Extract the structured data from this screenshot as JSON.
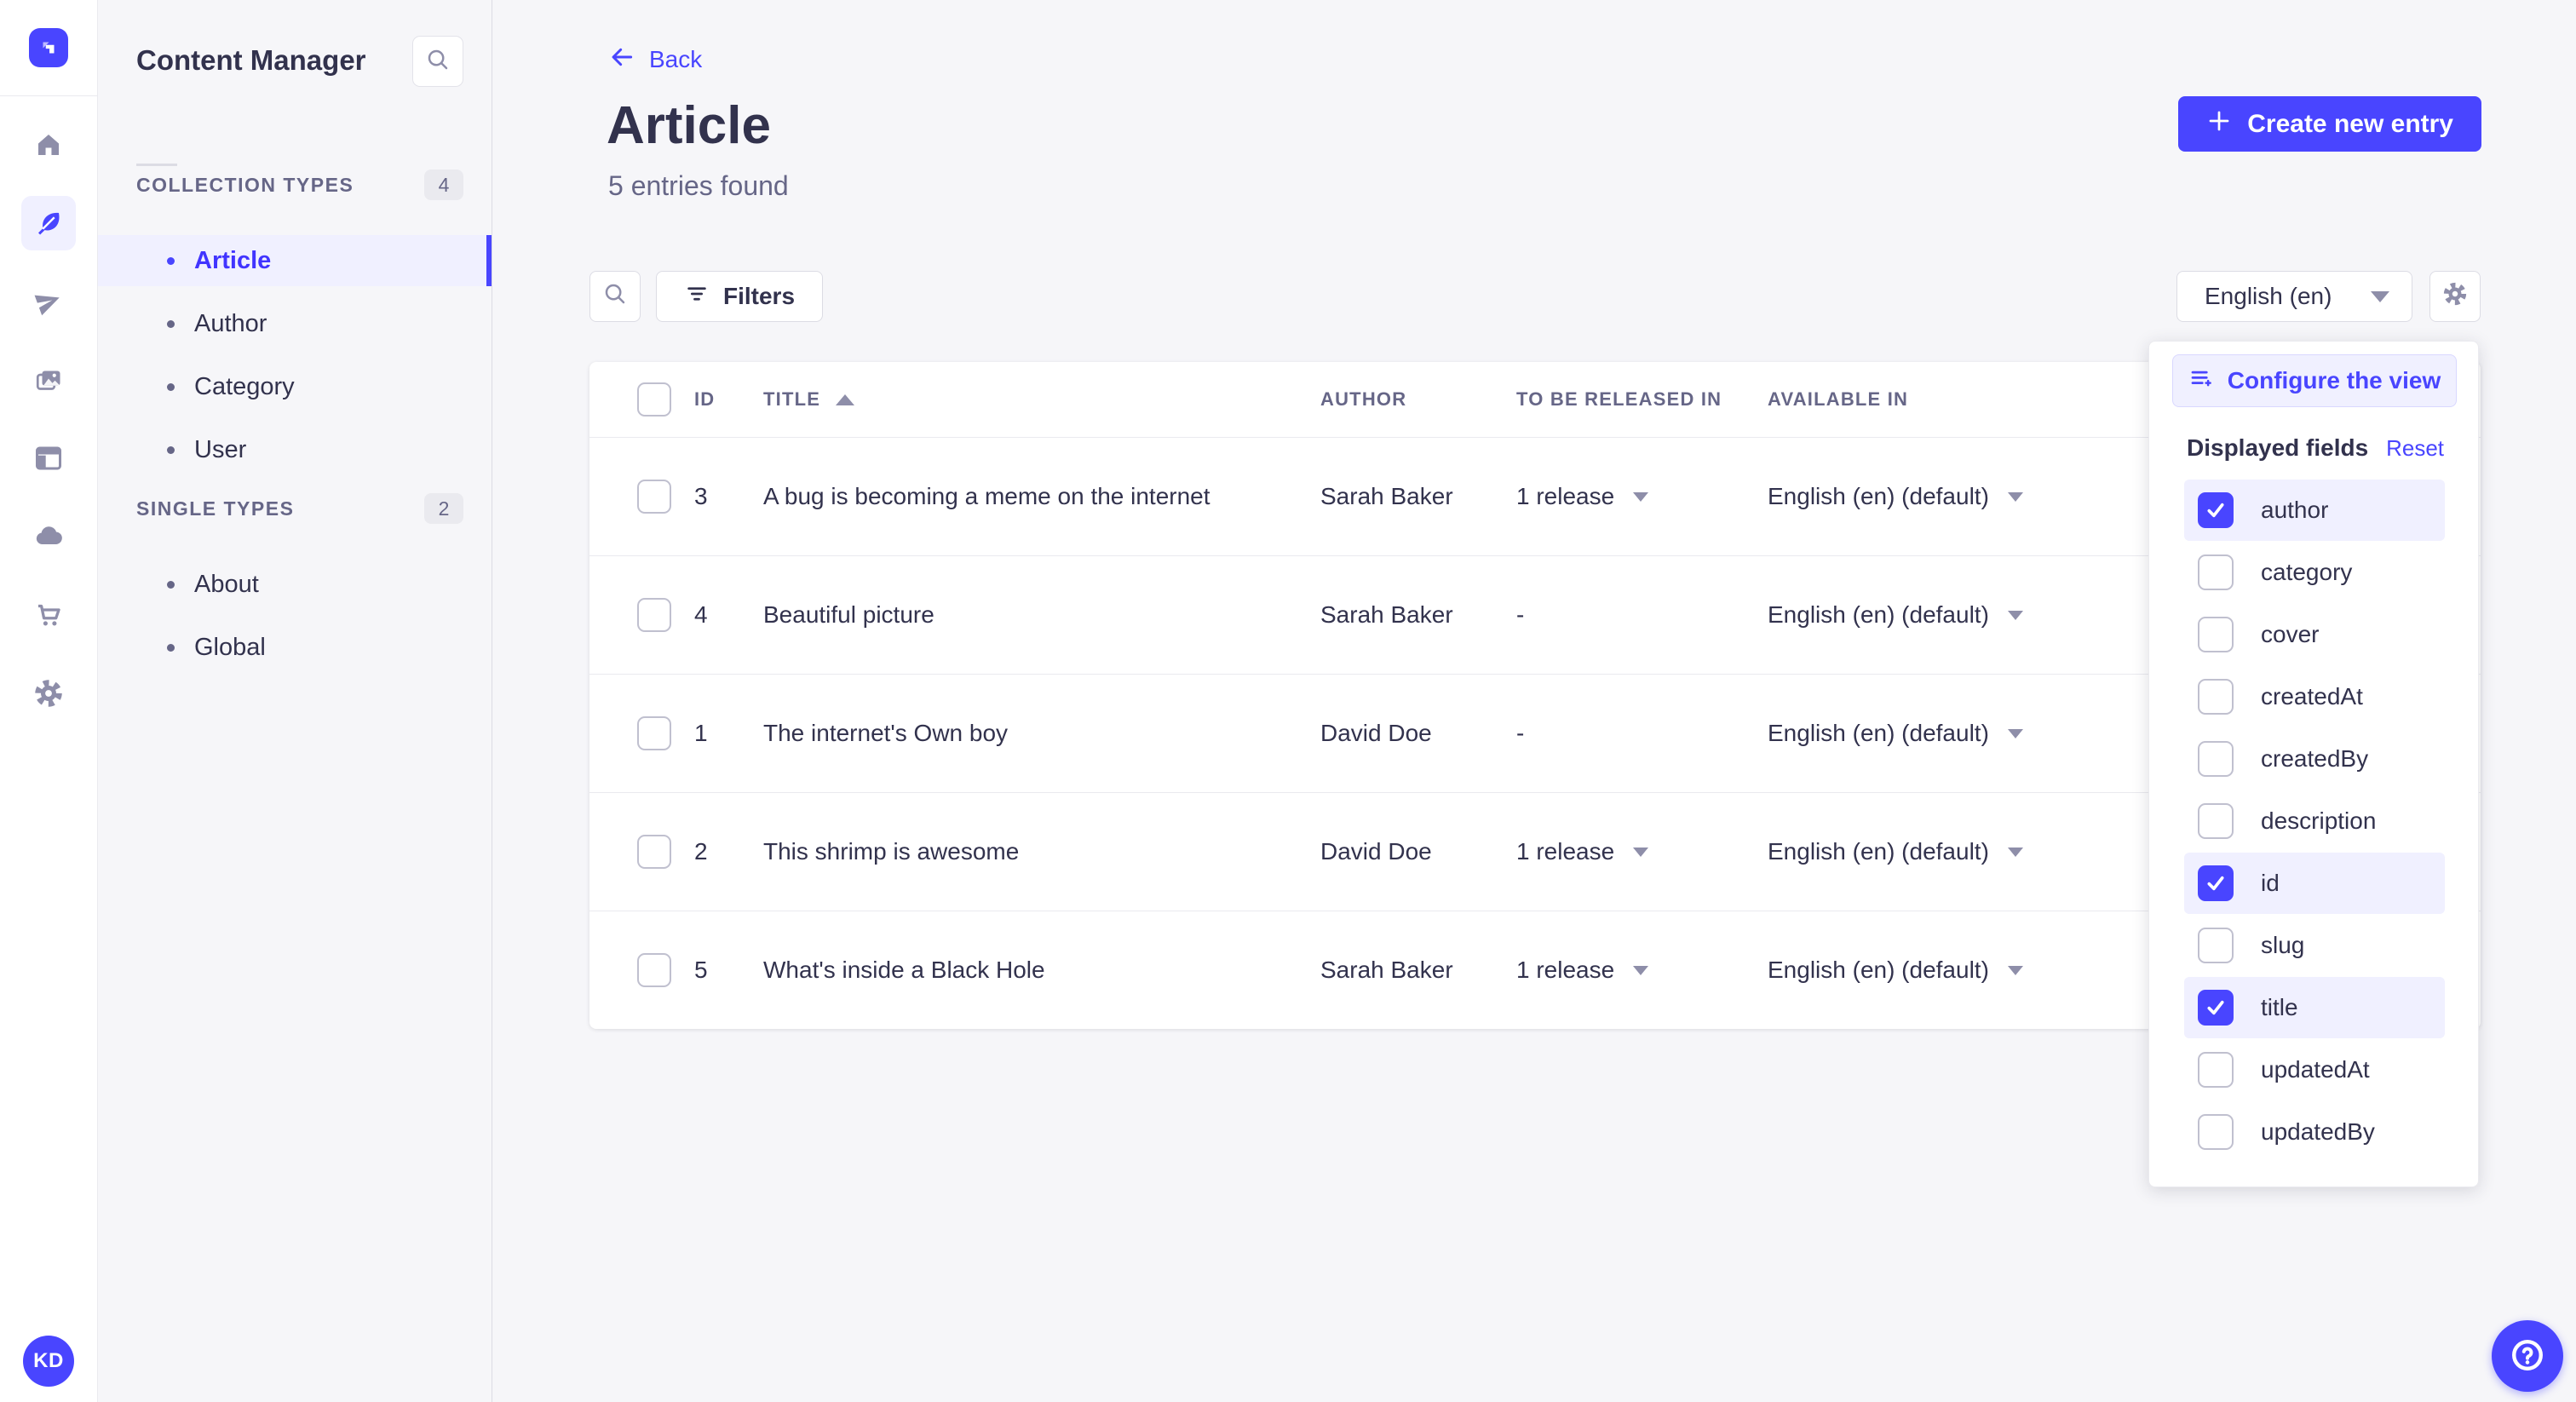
{
  "colors": {
    "primary": "#4945ff",
    "lavender": "#f0f0ff",
    "lavender_border": "#d9d8ff",
    "text": "#32324d",
    "muted": "#666687",
    "icon": "#8e8ea9",
    "border": "#dcdce4",
    "page_bg": "#f6f6f9"
  },
  "nav_rail": {
    "logo_icon": "strapi-logo",
    "icons": [
      "home-icon",
      "content-manager-feather-icon",
      "releases-paper-plane-icon",
      "media-library-images-icon",
      "content-type-builder-layout-icon",
      "deploy-cloud-icon",
      "marketplace-cart-icon",
      "settings-gear-icon"
    ],
    "active_icon": "content-manager-feather-icon",
    "avatar_initials": "KD"
  },
  "sidebar": {
    "title": "Content Manager",
    "search_icon": "search-icon",
    "sections": [
      {
        "label": "COLLECTION TYPES",
        "badge": "4",
        "items": [
          {
            "label": "Article",
            "active": true
          },
          {
            "label": "Author",
            "active": false
          },
          {
            "label": "Category",
            "active": false
          },
          {
            "label": "User",
            "active": false
          }
        ]
      },
      {
        "label": "SINGLE TYPES",
        "badge": "2",
        "items": [
          {
            "label": "About",
            "active": false
          },
          {
            "label": "Global",
            "active": false
          }
        ]
      }
    ]
  },
  "header": {
    "back_label": "Back",
    "title": "Article",
    "subtitle": "5 entries found",
    "create_button_label": "Create new entry"
  },
  "toolbar": {
    "filters_label": "Filters",
    "locale_selected": "English (en)"
  },
  "table": {
    "columns": {
      "id": "ID",
      "title": "TITLE",
      "author": "AUTHOR",
      "release": "TO BE RELEASED IN",
      "available": "AVAILABLE IN"
    },
    "sorted_column": "TITLE",
    "sort_direction": "asc",
    "rows": [
      {
        "id": "3",
        "title": "A bug is becoming a meme on the internet",
        "author": "Sarah Baker",
        "release": "1 release",
        "available": "English (en) (default)"
      },
      {
        "id": "4",
        "title": "Beautiful picture",
        "author": "Sarah Baker",
        "release": "-",
        "available": "English (en) (default)"
      },
      {
        "id": "1",
        "title": "The internet's Own boy",
        "author": "David Doe",
        "release": "-",
        "available": "English (en) (default)"
      },
      {
        "id": "2",
        "title": "This shrimp is awesome",
        "author": "David Doe",
        "release": "1 release",
        "available": "English (en) (default)"
      },
      {
        "id": "5",
        "title": "What's inside a Black Hole",
        "author": "Sarah Baker",
        "release": "1 release",
        "available": "English (en) (default)"
      }
    ]
  },
  "popover": {
    "configure_label": "Configure the view",
    "configure_icon": "list-plus-icon",
    "displayed_fields_label": "Displayed fields",
    "reset_label": "Reset",
    "fields": [
      {
        "label": "author",
        "checked": true
      },
      {
        "label": "category",
        "checked": false
      },
      {
        "label": "cover",
        "checked": false
      },
      {
        "label": "createdAt",
        "checked": false
      },
      {
        "label": "createdBy",
        "checked": false
      },
      {
        "label": "description",
        "checked": false
      },
      {
        "label": "id",
        "checked": true
      },
      {
        "label": "slug",
        "checked": false
      },
      {
        "label": "title",
        "checked": true
      },
      {
        "label": "updatedAt",
        "checked": false
      },
      {
        "label": "updatedBy",
        "checked": false
      }
    ]
  },
  "floating": {
    "help_icon": "question-circle-icon"
  }
}
